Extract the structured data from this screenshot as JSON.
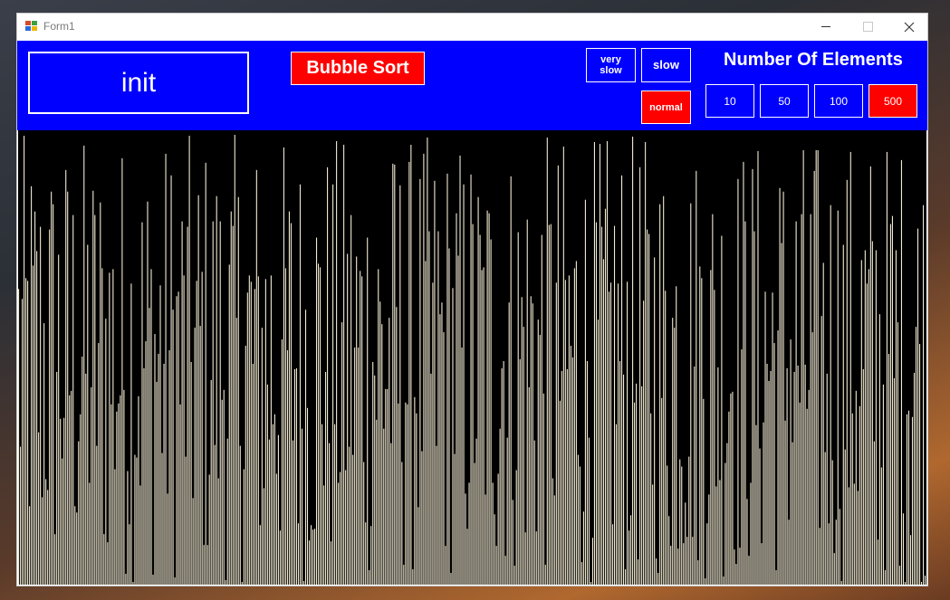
{
  "window": {
    "title": "Form1"
  },
  "toolbar": {
    "init_label": "init",
    "sort_label": "Bubble Sort",
    "speed": {
      "very_slow_label": "very\nslow",
      "slow_label": "slow",
      "normal_label": "normal",
      "selected": "normal"
    },
    "elements": {
      "title": "Number Of Elements",
      "options": [
        "10",
        "50",
        "100",
        "500"
      ],
      "selected": "500"
    }
  },
  "colors": {
    "toolbar_bg": "#0000ff",
    "selected_bg": "#ff0000",
    "canvas_bg": "#000000",
    "bar_color": "#f2ead2"
  },
  "visualization": {
    "element_count": 500,
    "max_value": 500
  }
}
